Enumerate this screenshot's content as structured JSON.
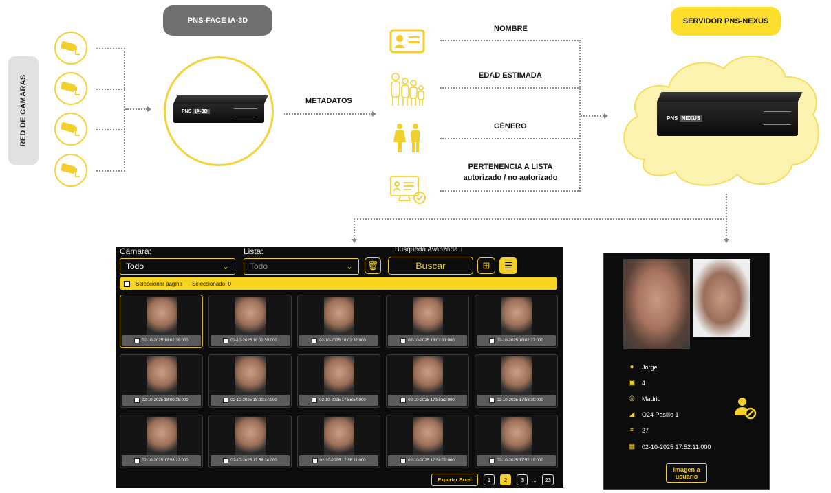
{
  "left_label": "RED DE CÁMARAS",
  "device_pill": "PNS-FACE IA-3D",
  "server_pill": "SERVIDOR PNS-NEXUS",
  "device_brand": "PNS",
  "device_model": "IA-3D",
  "server_brand": "PNS",
  "server_model": "NEXUS",
  "metadatos_label": "METADATOS",
  "metadata": [
    {
      "label": "NOMBRE",
      "icon": "id-card-icon"
    },
    {
      "label": "EDAD ESTIMADA",
      "icon": "family-icon"
    },
    {
      "label": "GÉNERO",
      "icon": "gender-icon"
    },
    {
      "label": "PERTENENCIA A LISTA",
      "sublabel": "autorizado / no autorizado",
      "icon": "list-monitor-icon"
    }
  ],
  "gallery": {
    "camara_label": "Cámara:",
    "camara_value": "Todo",
    "lista_label": "Lista:",
    "lista_value": "Todo",
    "advanced_search": "Búsqueda Avanzada ↓",
    "search_button": "Buscar",
    "select_page": "Seleccionar página",
    "selected_count": "Seleccionado: 0",
    "tiles": [
      "02-10-2025 18:02:39:000",
      "02-10-2025 18:02:35:000",
      "02-10-2025 18:02:32:000",
      "02-10-2025 18:02:31:000",
      "02-10-2025 18:02:27:000",
      "02-10-2025 18:00:38:000",
      "02-10-2025 18:00:37:000",
      "02-10-2025 17:58:54:000",
      "02-10-2025 17:58:52:000",
      "02-10-2025 17:58:30:000",
      "02-10-2025 17:58:22:000",
      "02-10-2025 17:58:14:000",
      "02-10-2025 17:58:11:000",
      "02-10-2025 17:58:09:000",
      "02-10-2025 17:52:19:000"
    ],
    "export_button": "Exportar Excel",
    "pages": [
      "1",
      "2",
      "3",
      "...",
      "23"
    ],
    "active_page": "2"
  },
  "detail": {
    "name": "Jorge",
    "id": "4",
    "location": "Madrid",
    "camera": "O24 Pasillo 1",
    "age": "27",
    "datetime": "02-10-2025 17:52:11:000",
    "image_button": "imagen a usuario"
  },
  "colors": {
    "accent": "#f2cf2a",
    "gray_pill": "#707070",
    "yellow_pill": "#fdde2d",
    "panel_bg": "#0c0c0c"
  }
}
